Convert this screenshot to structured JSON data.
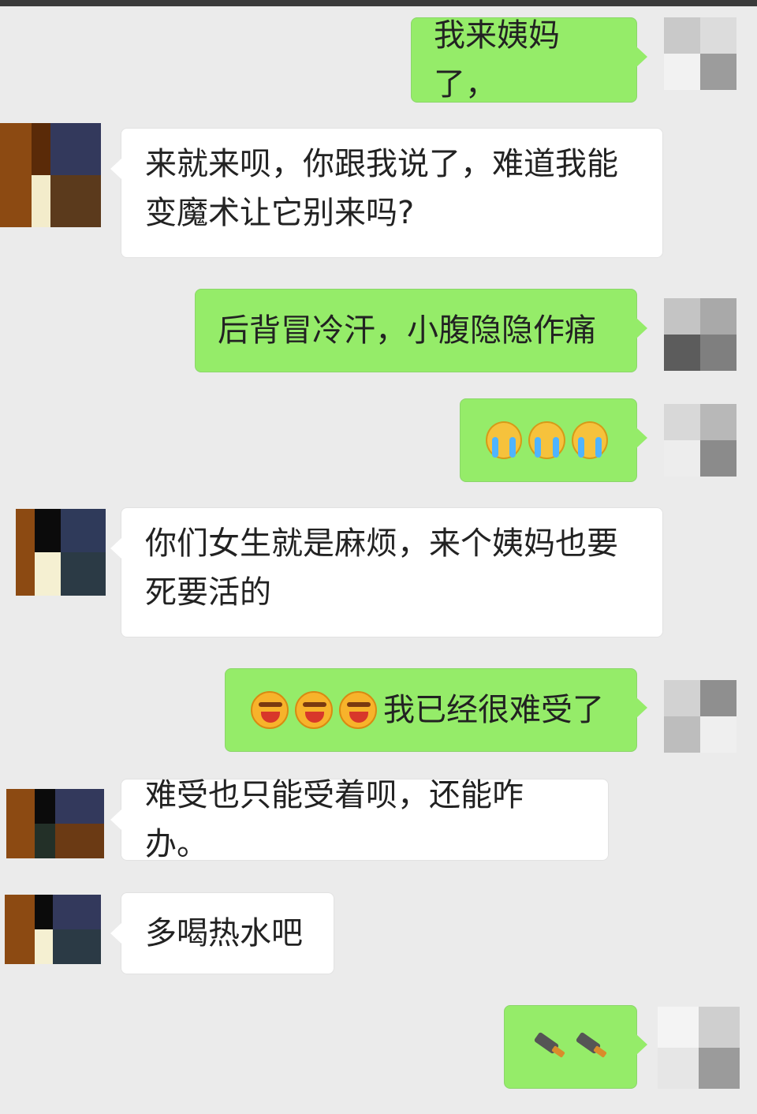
{
  "messages": [
    {
      "side": "mine",
      "text": "我来姨妈了，"
    },
    {
      "side": "other",
      "text": "来就来呗，你跟我说了，难道我能变魔术让它别来吗?"
    },
    {
      "side": "mine",
      "text": "后背冒冷汗，小腹隐隐作痛"
    },
    {
      "side": "mine",
      "emojis": [
        "crying-face-icon",
        "crying-face-icon",
        "crying-face-icon"
      ]
    },
    {
      "side": "other",
      "text": "你们女生就是麻烦，来个姨妈也要死要活的"
    },
    {
      "side": "mine",
      "emojis": [
        "laugh-cry-face-icon",
        "laugh-cry-face-icon",
        "laugh-cry-face-icon"
      ],
      "text": "我已经很难受了"
    },
    {
      "side": "other",
      "text": "难受也只能受着呗，还能咋办。"
    },
    {
      "side": "other",
      "text": "多喝热水吧"
    },
    {
      "side": "mine",
      "emojis": [
        "kitchen-knife-icon",
        "kitchen-knife-icon"
      ]
    }
  ],
  "colors": {
    "background": "#ebebeb",
    "bubble_mine": "#95ec69",
    "bubble_other": "#ffffff"
  }
}
